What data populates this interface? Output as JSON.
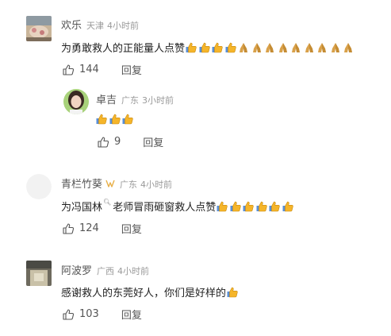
{
  "comments": [
    {
      "username": "欢乐",
      "location": "天津",
      "time": "4小时前",
      "text": "为勇敢救人的正能量人点赞",
      "emojis": [
        "thumbs-up",
        "thumbs-up",
        "thumbs-up",
        "thumbs-up",
        "folded-hands",
        "folded-hands",
        "folded-hands",
        "folded-hands",
        "folded-hands",
        "folded-hands",
        "folded-hands",
        "folded-hands",
        "folded-hands"
      ],
      "likes": "144",
      "reply_label": "回复"
    },
    {
      "username": "卓吉",
      "location": "广东",
      "time": "3小时前",
      "text": "",
      "emojis": [
        "thumbs-up",
        "thumbs-up",
        "thumbs-up"
      ],
      "likes": "9",
      "reply_label": "回复"
    },
    {
      "username": "青栏竹葵",
      "location": "广东",
      "time": "4小时前",
      "text_prefix": "为",
      "text_link": "冯国林",
      "text_suffix": "老师冒雨砸窗救人点赞",
      "emojis": [
        "thumbs-up",
        "thumbs-up",
        "thumbs-up",
        "thumbs-up",
        "thumbs-up",
        "thumbs-up"
      ],
      "likes": "124",
      "reply_label": "回复"
    },
    {
      "username": "阿波罗",
      "location": "广西",
      "time": "4小时前",
      "text": "感谢救人的东莞好人，你们是好样的",
      "emojis": [
        "thumbs-up"
      ],
      "likes": "103",
      "reply_label": "回复"
    }
  ],
  "colors": {
    "thumb": "#f5b52a",
    "hands": "#d9a14a",
    "vip_badge": "#e8b04a"
  }
}
